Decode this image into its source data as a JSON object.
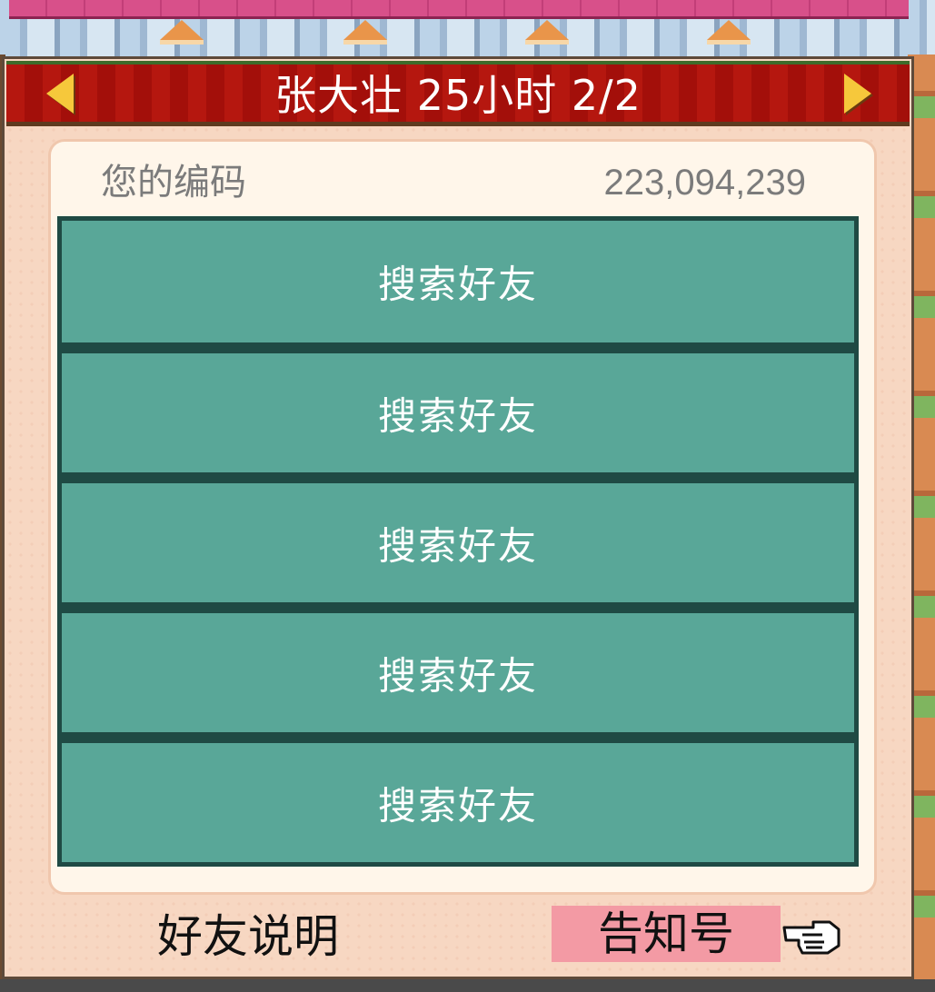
{
  "dialog": {
    "title": "张大壮  25小时 2/2",
    "code_label": "您的编码",
    "code_value": "223,094,239"
  },
  "friend_slots": [
    {
      "label": "搜索好友"
    },
    {
      "label": "搜索好友"
    },
    {
      "label": "搜索好友"
    },
    {
      "label": "搜索好友"
    },
    {
      "label": "搜索好友"
    }
  ],
  "footer": {
    "friend_info_label": "好友说明",
    "notice_label": "告知号"
  },
  "icons": {
    "prev": "arrow-left-icon",
    "next": "arrow-right-icon",
    "pointer": "pointing-hand-icon"
  },
  "colors": {
    "title_bar": "#b5170f",
    "slot": "#59a798",
    "slot_border": "#1f4a44",
    "notice_button": "#f39aa4",
    "arrow": "#f6c83b"
  }
}
